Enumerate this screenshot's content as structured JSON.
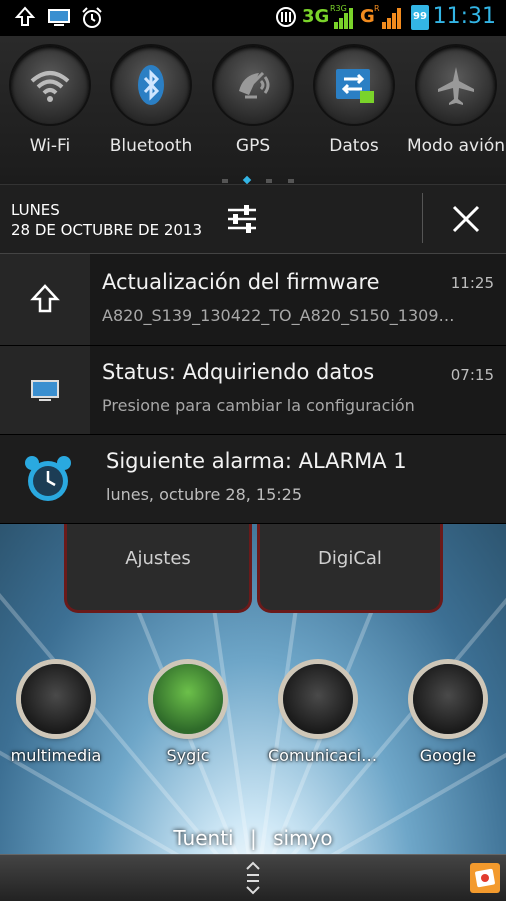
{
  "status_bar": {
    "time": "11:31",
    "battery": "99",
    "network_1": "3G",
    "network_1_sub": "R3G",
    "network_2": "G",
    "network_2_sub": "R",
    "accent_color": "#33b5e5",
    "signal_color": "#7ad32a",
    "signal2_color": "#f28b1e"
  },
  "quick_settings": {
    "tiles": [
      {
        "label": "Wi-Fi",
        "icon": "wifi-icon"
      },
      {
        "label": "Bluetooth",
        "icon": "bluetooth-icon"
      },
      {
        "label": "GPS",
        "icon": "gps-icon"
      },
      {
        "label": "Datos",
        "icon": "data-icon"
      },
      {
        "label": "Modo avión",
        "icon": "airplane-icon"
      }
    ]
  },
  "header": {
    "day": "LUNES",
    "date": "28 DE OCTUBRE DE 2013"
  },
  "notifications": [
    {
      "title": "Actualización del firmware",
      "text": "A820_S139_130422_TO_A820_S150_1309…",
      "time": "11:25",
      "icon": "upload-arrow-icon"
    },
    {
      "title": "Status: Adquiriendo datos",
      "text": "Presione para cambiar la configuración",
      "time": "07:15",
      "icon": "monitor-icon"
    },
    {
      "title": "Siguiente alarma: ALARMA 1",
      "text": "lunes, octubre 28, 15:25",
      "time": "",
      "icon": "alarm-clock-icon"
    }
  ],
  "home": {
    "panels": [
      {
        "label": "Ajustes"
      },
      {
        "label": "DigiCal"
      }
    ],
    "apps": [
      {
        "label": "multimedia"
      },
      {
        "label": "Sygic"
      },
      {
        "label": "Comunicaci…"
      },
      {
        "label": "Google"
      }
    ],
    "dock_left": "Tuenti",
    "dock_sep": "|",
    "dock_right": "simyo"
  }
}
